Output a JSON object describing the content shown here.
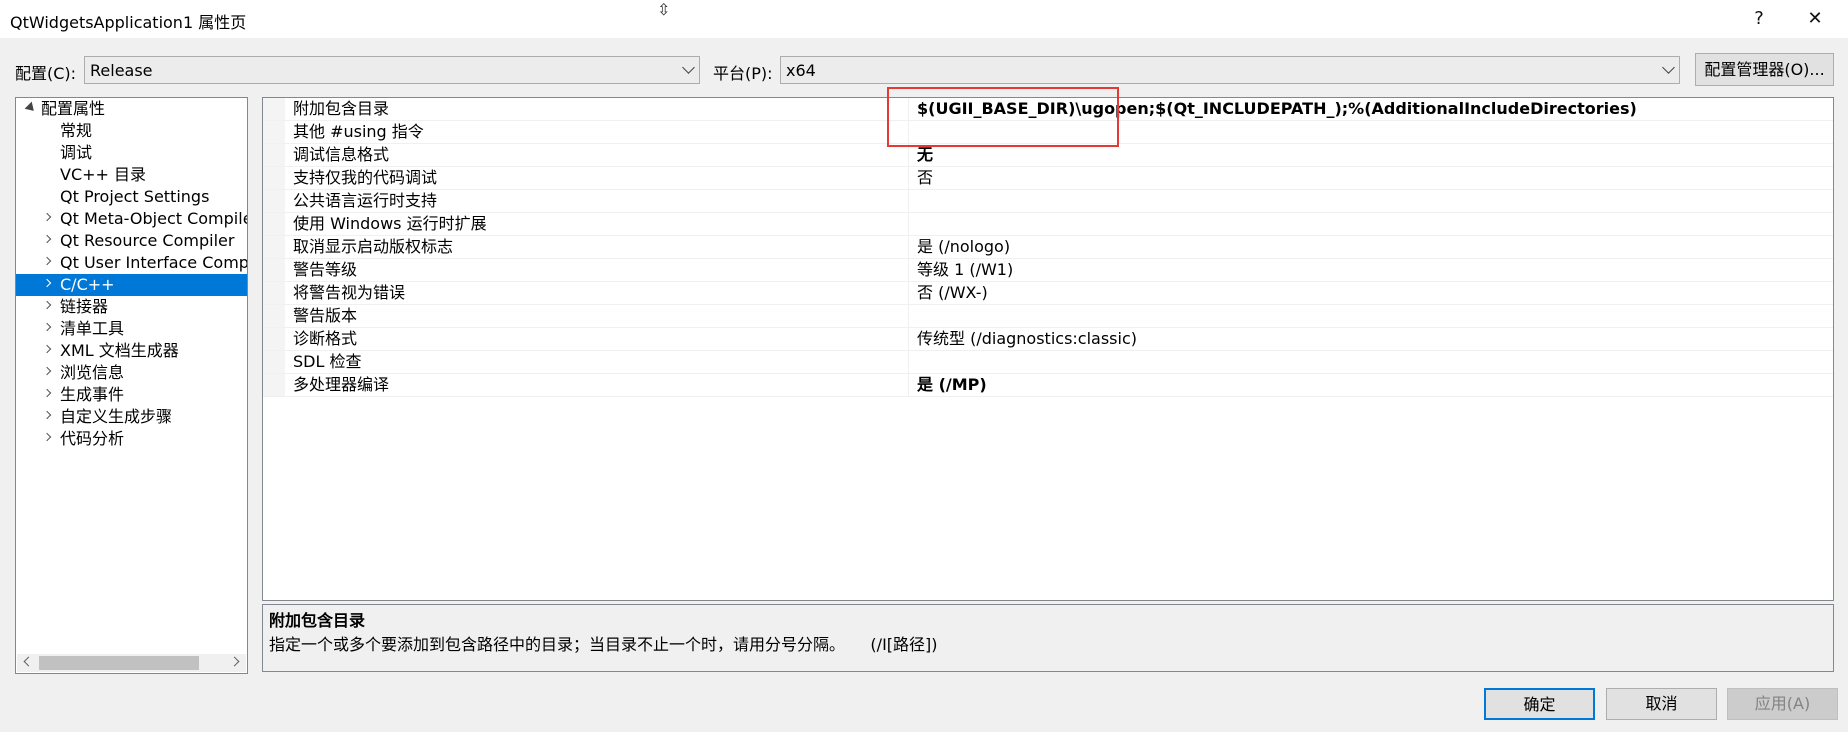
{
  "window": {
    "title": "QtWidgetsApplication1 属性页",
    "help_label": "?",
    "close_label": "✕"
  },
  "config": {
    "config_label": "配置(C):",
    "config_value": "Release",
    "platform_label": "平台(P):",
    "platform_value": "x64",
    "manager_button": "配置管理器(O)..."
  },
  "tree": {
    "items": [
      {
        "label": "配置属性"
      },
      {
        "label": "常规"
      },
      {
        "label": "调试"
      },
      {
        "label": "VC++ 目录"
      },
      {
        "label": "Qt Project Settings"
      },
      {
        "label": "Qt Meta-Object Compiler"
      },
      {
        "label": "Qt Resource Compiler"
      },
      {
        "label": "Qt User Interface Compile"
      },
      {
        "label": "C/C++"
      },
      {
        "label": "链接器"
      },
      {
        "label": "清单工具"
      },
      {
        "label": "XML 文档生成器"
      },
      {
        "label": "浏览信息"
      },
      {
        "label": "生成事件"
      },
      {
        "label": "自定义生成步骤"
      },
      {
        "label": "代码分析"
      }
    ]
  },
  "grid": {
    "rows": [
      {
        "name": "附加包含目录",
        "value": "$(UGII_BASE_DIR)\\ugopen;$(Qt_INCLUDEPATH_);%(AdditionalIncludeDirectories)",
        "bold": true
      },
      {
        "name": "其他 #using 指令",
        "value": "",
        "bold": false
      },
      {
        "name": "调试信息格式",
        "value": "无",
        "bold": true
      },
      {
        "name": "支持仅我的代码调试",
        "value": "否",
        "bold": false
      },
      {
        "name": "公共语言运行时支持",
        "value": "",
        "bold": false
      },
      {
        "name": "使用 Windows 运行时扩展",
        "value": "",
        "bold": false
      },
      {
        "name": "取消显示启动版权标志",
        "value": "是 (/nologo)",
        "bold": false
      },
      {
        "name": "警告等级",
        "value": "等级 1 (/W1)",
        "bold": false
      },
      {
        "name": "将警告视为错误",
        "value": "否 (/WX-)",
        "bold": false
      },
      {
        "name": "警告版本",
        "value": "",
        "bold": false
      },
      {
        "name": "诊断格式",
        "value": "传统型 (/diagnostics:classic)",
        "bold": false
      },
      {
        "name": "SDL 检查",
        "value": "",
        "bold": false
      },
      {
        "name": "多处理器编译",
        "value": "是 (/MP)",
        "bold": true
      }
    ]
  },
  "description": {
    "title": "附加包含目录",
    "text": "指定一个或多个要添加到包含路径中的目录；当目录不止一个时，请用分号分隔。     (/I[路径])"
  },
  "buttons": {
    "ok": "确定",
    "cancel": "取消",
    "apply": "应用(A)"
  }
}
